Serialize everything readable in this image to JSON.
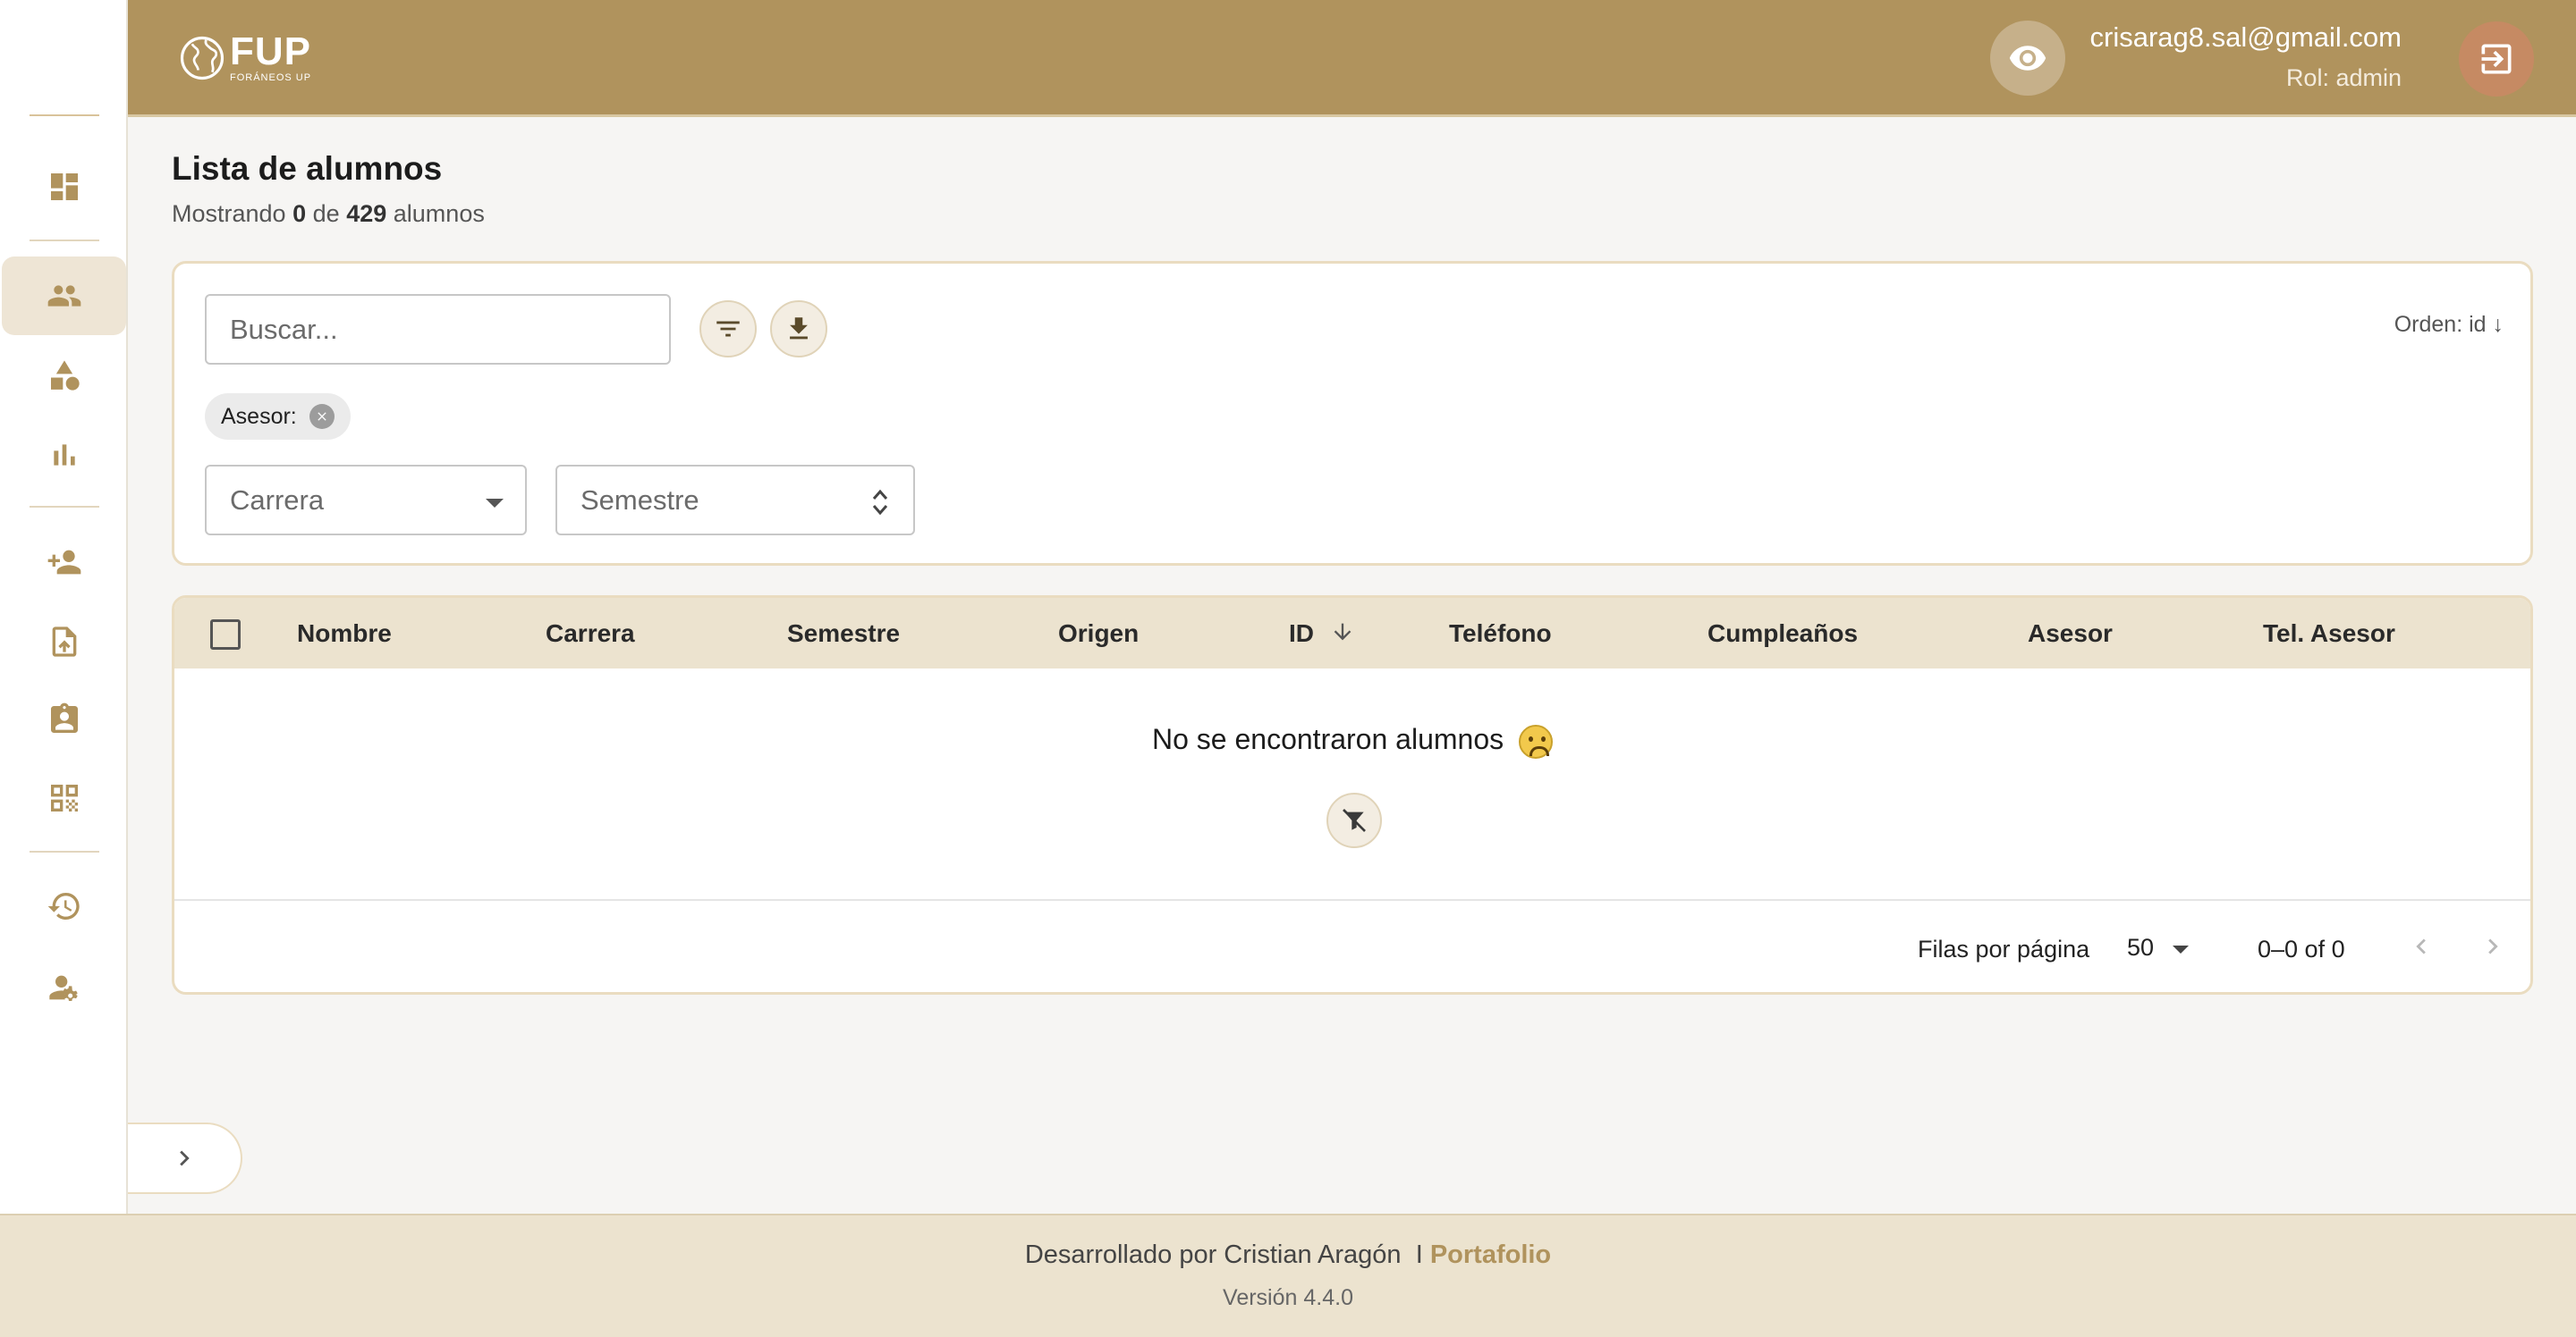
{
  "brand": {
    "logo_main": "FUP",
    "logo_sub": "FORÁNEOS UP"
  },
  "header": {
    "user_email": "crisarag8.sal@gmail.com",
    "user_role": "Rol: admin"
  },
  "sidebar": {
    "items": [
      {
        "name": "dashboard",
        "icon": "dashboard-icon"
      },
      {
        "name": "students",
        "icon": "people-icon",
        "active": true
      },
      {
        "name": "categories",
        "icon": "shapes-icon"
      },
      {
        "name": "stats",
        "icon": "bar-chart-icon"
      },
      {
        "name": "add-student",
        "icon": "person-add-icon"
      },
      {
        "name": "upload",
        "icon": "file-upload-icon"
      },
      {
        "name": "assignments",
        "icon": "clipboard-person-icon"
      },
      {
        "name": "qr",
        "icon": "qr-code-icon"
      },
      {
        "name": "history",
        "icon": "history-icon"
      },
      {
        "name": "user-settings",
        "icon": "user-gear-icon"
      }
    ]
  },
  "page": {
    "title": "Lista de alumnos",
    "subtitle_prefix": "Mostrando",
    "shown_count": "0",
    "subtitle_mid": "de",
    "total_count": "429",
    "subtitle_suffix": "alumnos"
  },
  "filters": {
    "search_placeholder": "Buscar...",
    "order_label": "Orden: id ↓",
    "chip_label": "Asesor:",
    "career_placeholder": "Carrera",
    "semester_placeholder": "Semestre"
  },
  "table": {
    "columns": [
      "Nombre",
      "Carrera",
      "Semestre",
      "Origen",
      "ID",
      "Teléfono",
      "Cumpleaños",
      "Asesor",
      "Tel. Asesor"
    ],
    "empty_message": "No se encontraron alumnos",
    "rows_per_page_label": "Filas por página",
    "rows_per_page": "50",
    "range_label": "0–0 of 0"
  },
  "footer": {
    "credit": "Desarrollado por Cristian Aragón",
    "separator": "I",
    "link_label": "Portafolio",
    "version": "Versión 4.4.0"
  },
  "colors": {
    "accent": "#b0935d",
    "accent_light": "#ece3cf",
    "logout": "#c68a63"
  }
}
